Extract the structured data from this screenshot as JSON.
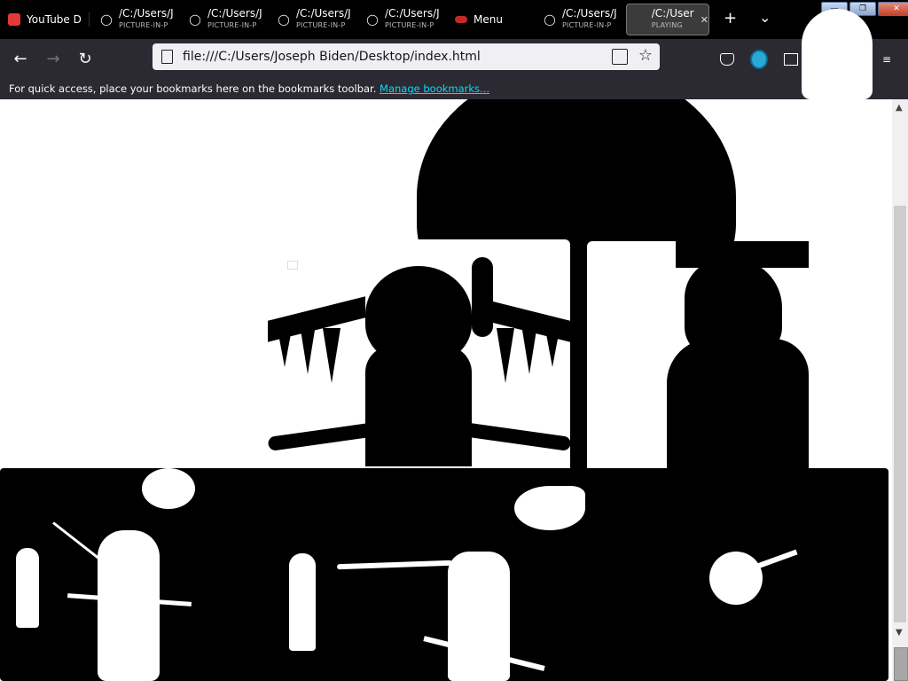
{
  "tabs": [
    {
      "title": "YouTube D",
      "subtitle": "",
      "icon": "youtube-downloader-icon"
    },
    {
      "title": "/C:/Users/J",
      "subtitle": "PICTURE-IN-P",
      "icon": "globe-icon"
    },
    {
      "title": "/C:/Users/J",
      "subtitle": "PICTURE-IN-P",
      "icon": "globe-icon"
    },
    {
      "title": "/C:/Users/J",
      "subtitle": "PICTURE-IN-P",
      "icon": "globe-icon"
    },
    {
      "title": "/C:/Users/J",
      "subtitle": "PICTURE-IN-P",
      "icon": "globe-icon"
    },
    {
      "title": "Menu",
      "subtitle": "",
      "icon": "menu-icon"
    },
    {
      "title": "/C:/Users/J",
      "subtitle": "PICTURE-IN-P",
      "icon": "globe-icon"
    },
    {
      "title": "/C:/User",
      "subtitle": "PLAYING",
      "icon": "speaker-icon",
      "active": true
    }
  ],
  "tabbar": {
    "new_tab": "+",
    "list_tabs": "⌄",
    "close_tab": "✕"
  },
  "window": {
    "minimize": "—",
    "restore": "❐",
    "close": "✕"
  },
  "navbar": {
    "url": "file:///C:/Users/Joseph Biden/Desktop/index.html",
    "back": "←",
    "forward": "→",
    "reload": "↻",
    "bookmark_star": "☆",
    "extensions": [
      "pocket-icon",
      "browser-extension-icon",
      "container-icon",
      "ublock-origin-icon",
      "youtube-extension-icon",
      "menu-icon"
    ]
  },
  "bookmarks_bar": {
    "message": "For quick access, place your bookmarks here on the bookmarks toolbar.",
    "link": "Manage bookmarks..."
  },
  "scrollbar": {
    "up": "▲",
    "down": "▼"
  },
  "colors": {
    "tabbar_bg": "#000000",
    "toolbar_bg": "#2b2a33",
    "url_bg": "#f0f0f4",
    "link": "#00ddff",
    "page_bg": "#ffffff"
  }
}
